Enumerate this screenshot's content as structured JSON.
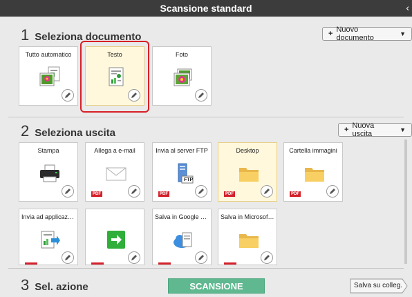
{
  "title": "Scansione standard",
  "section1": {
    "number": "1",
    "label": "Seleziona documento",
    "new_button": "Nuovo documento"
  },
  "documents": [
    {
      "name": "Tutto automatico"
    },
    {
      "name": "Testo"
    },
    {
      "name": "Foto"
    }
  ],
  "section2": {
    "number": "2",
    "label": "Seleziona uscita",
    "new_button": "Nuova uscita"
  },
  "outputs_row1": [
    {
      "name": "Stampa"
    },
    {
      "name": "Allega a e-mail",
      "badge": "PDF"
    },
    {
      "name": "Invia al server FTP",
      "badge": "PDF",
      "icon_text": "FTP"
    },
    {
      "name": "Desktop",
      "badge": "PDF"
    },
    {
      "name": "Cartella immagini",
      "badge": "PDF"
    }
  ],
  "outputs_row2": [
    {
      "name": "Invia ad applicazio..."
    },
    {
      "name": ""
    },
    {
      "name": "Salva in Google do..."
    },
    {
      "name": "Salva in Microsoft ..."
    }
  ],
  "section3": {
    "number": "3",
    "label": "Sel. azione",
    "scan_button": "SCANSIONE",
    "save_button": "Salva su colleg."
  }
}
